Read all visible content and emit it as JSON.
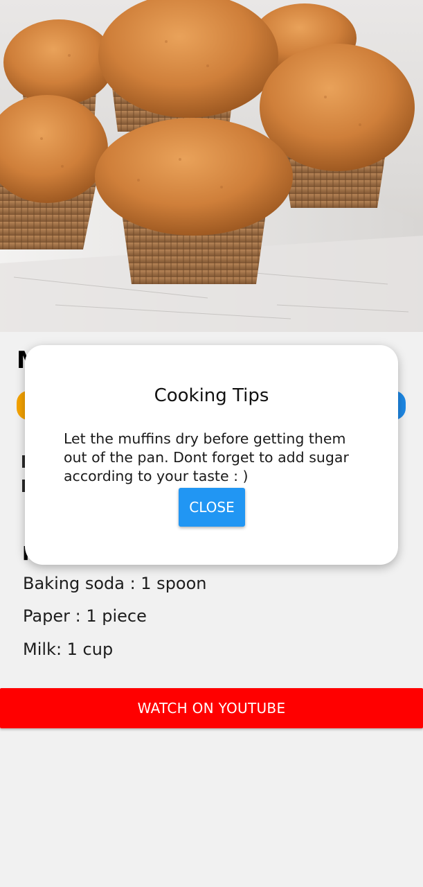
{
  "hero_image": {
    "icon": "muffins-photo"
  },
  "page": {
    "heading_partial": "M",
    "ingredients_heading_partial": "I"
  },
  "ingredients": [
    "Baking soda : 1 spoon",
    "Paper : 1 piece",
    "Milk: 1 cup"
  ],
  "youtube_button": {
    "label": "WATCH ON YOUTUBE",
    "color": "#ff0000"
  },
  "dialog": {
    "title": "Cooking Tips",
    "body": "Let the muffins dry before getting them out of the pan. Dont forget to add sugar according to your taste : )",
    "close_label": "CLOSE",
    "close_color": "#2196f3"
  },
  "colors": {
    "chip_left": "#f5a300",
    "chip_right": "#1e88e5",
    "background": "#f1f1f1"
  }
}
